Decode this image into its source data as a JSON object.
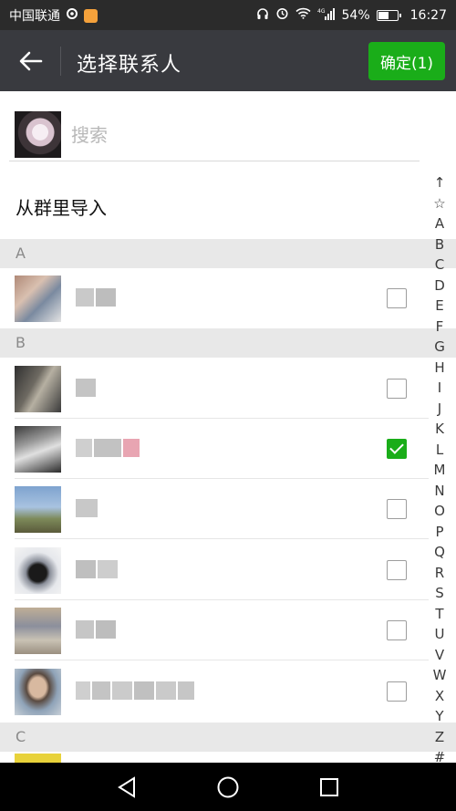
{
  "status_bar": {
    "carrier": "中国联通",
    "battery_text": "54%",
    "battery_level": 0.54,
    "time": "16:27",
    "network": "4G"
  },
  "header": {
    "back_icon": "arrow-left-icon",
    "title": "选择联系人",
    "confirm_label": "确定(1)",
    "confirm_color": "#1aad19",
    "bar_color": "#393a3f"
  },
  "search": {
    "placeholder": "搜索",
    "value": ""
  },
  "group_import": {
    "label": "从群里导入"
  },
  "sections": [
    {
      "letter": "A"
    },
    {
      "letter": "B"
    },
    {
      "letter": "C"
    }
  ],
  "contacts": [
    {
      "section": "A",
      "name_obscured": true,
      "checked": false
    },
    {
      "section": "B",
      "name_obscured": true,
      "checked": false
    },
    {
      "section": "B",
      "name_obscured": true,
      "checked": true
    },
    {
      "section": "B",
      "name_obscured": true,
      "checked": false
    },
    {
      "section": "B",
      "name_obscured": true,
      "checked": false
    },
    {
      "section": "B",
      "name_obscured": true,
      "checked": false
    },
    {
      "section": "B",
      "name_obscured": true,
      "checked": false
    }
  ],
  "index_bar": [
    "↑",
    "☆",
    "A",
    "B",
    "C",
    "D",
    "E",
    "F",
    "G",
    "H",
    "I",
    "J",
    "K",
    "L",
    "M",
    "N",
    "O",
    "P",
    "Q",
    "R",
    "S",
    "T",
    "U",
    "V",
    "W",
    "X",
    "Y",
    "Z",
    "#"
  ],
  "nav_bar": {
    "back_icon": "triangle-back-icon",
    "home_icon": "circle-home-icon",
    "recents_icon": "square-recents-icon"
  }
}
